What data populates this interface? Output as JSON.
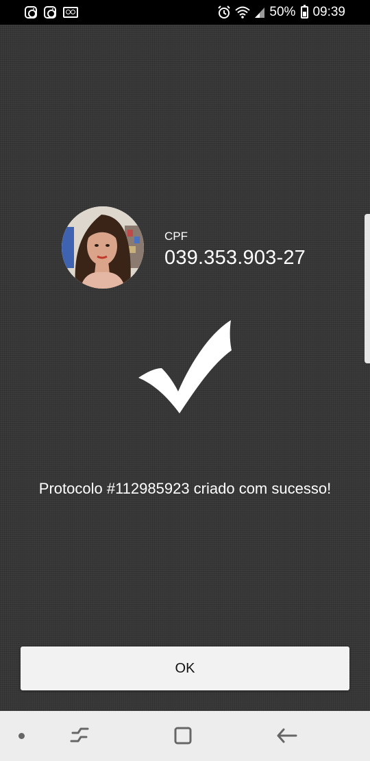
{
  "status_bar": {
    "battery": "50%",
    "time": "09:39",
    "icons_left": [
      "instagram-icon",
      "instagram-icon",
      "voicemail-icon"
    ],
    "icons_right": [
      "alarm-icon",
      "wifi-icon",
      "signal-icon",
      "battery-icon"
    ]
  },
  "profile": {
    "cpf_label": "CPF",
    "cpf_value": "039.353.903-27"
  },
  "result": {
    "message": "Protocolo #112985923 criado com sucesso!"
  },
  "actions": {
    "ok_label": "OK"
  },
  "navigation": {
    "buttons": [
      "recents-button",
      "home-button",
      "back-button"
    ]
  },
  "colors": {
    "background": "#3b3b3b",
    "status_bar": "#000000",
    "button_bg": "#f2f2f2",
    "nav_bar": "#ededed"
  }
}
